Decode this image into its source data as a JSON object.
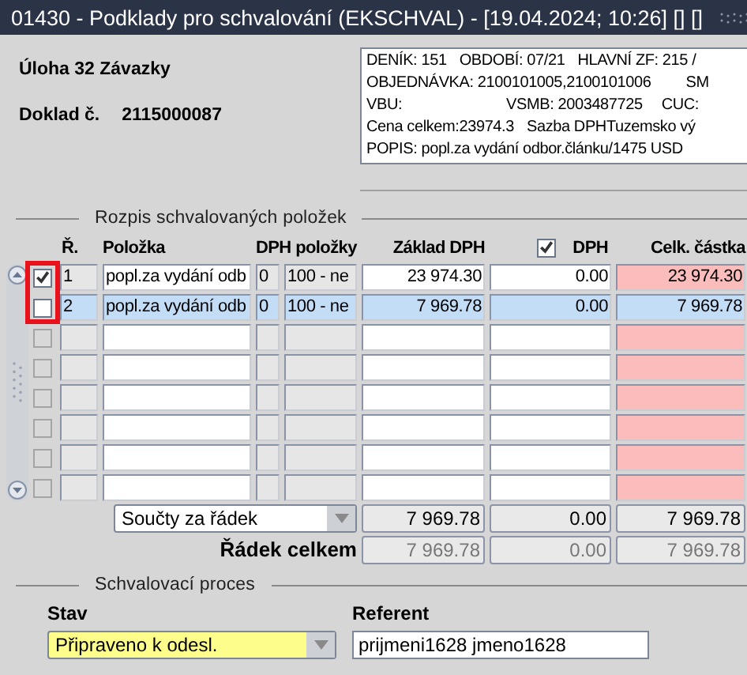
{
  "window": {
    "title": "01430 - Podklady pro schvalování (EKSCHVAL) - [19.04.2024; 10:26] [] []"
  },
  "header": {
    "task": "Úloha 32 Závazky",
    "doc_label": "Doklad č.",
    "doc_number": "2115000087"
  },
  "info_lines": [
    [
      "DENÍK: 151",
      "OBDOBÍ: 07/21",
      "HLAVNÍ ZF: 215 /"
    ],
    [
      "OBJEDNÁVKA: 2100101005,2100101006",
      "SM"
    ],
    [
      "VBU:",
      "VSMB: 2003487725",
      "CUC:"
    ],
    [
      "Cena celkem:23974.3",
      "Sazba DPHTuzemsko vý"
    ],
    [
      "POPIS: popl.za vydání odbor.článku/1475 USD"
    ]
  ],
  "items_section": {
    "title": "Rozpis schvalovaných položek",
    "columns": [
      "Ř.",
      "Položka",
      "DPH položky",
      "Základ DPH",
      "DPH",
      "Celk. částka"
    ],
    "header_checkbox": {
      "checked": true
    },
    "rows": [
      {
        "checked": true,
        "selected": false,
        "disabled": false,
        "number": "1",
        "item": "popl.za vydání odb",
        "vat_code": "0",
        "vat_text": "100 - ne",
        "base": "23 974.30",
        "vat": "0.00",
        "total": "23 974.30"
      },
      {
        "checked": false,
        "selected": true,
        "disabled": false,
        "number": "2",
        "item": "popl.za vydání odb",
        "vat_code": "0",
        "vat_text": "100 - ne",
        "base": "7 969.78",
        "vat": "0.00",
        "total": "7 969.78"
      },
      {
        "checked": false,
        "selected": false,
        "disabled": true
      },
      {
        "checked": false,
        "selected": false,
        "disabled": true
      },
      {
        "checked": false,
        "selected": false,
        "disabled": true
      },
      {
        "checked": false,
        "selected": false,
        "disabled": true
      },
      {
        "checked": false,
        "selected": false,
        "disabled": true
      },
      {
        "checked": false,
        "selected": false,
        "disabled": true
      }
    ],
    "sum_select": "Součty za řádek",
    "sum_values": [
      "7 969.78",
      "0.00",
      "7 969.78"
    ],
    "total_label": "Řádek celkem",
    "total_values": [
      "7 969.78",
      "0.00",
      "7 969.78"
    ]
  },
  "approval": {
    "title": "Schvalovací proces",
    "state_label": "Stav",
    "state_value": "Připraveno k odesl.",
    "referent_label": "Referent",
    "referent_value": "prijmeni1628 jmeno1628"
  }
}
